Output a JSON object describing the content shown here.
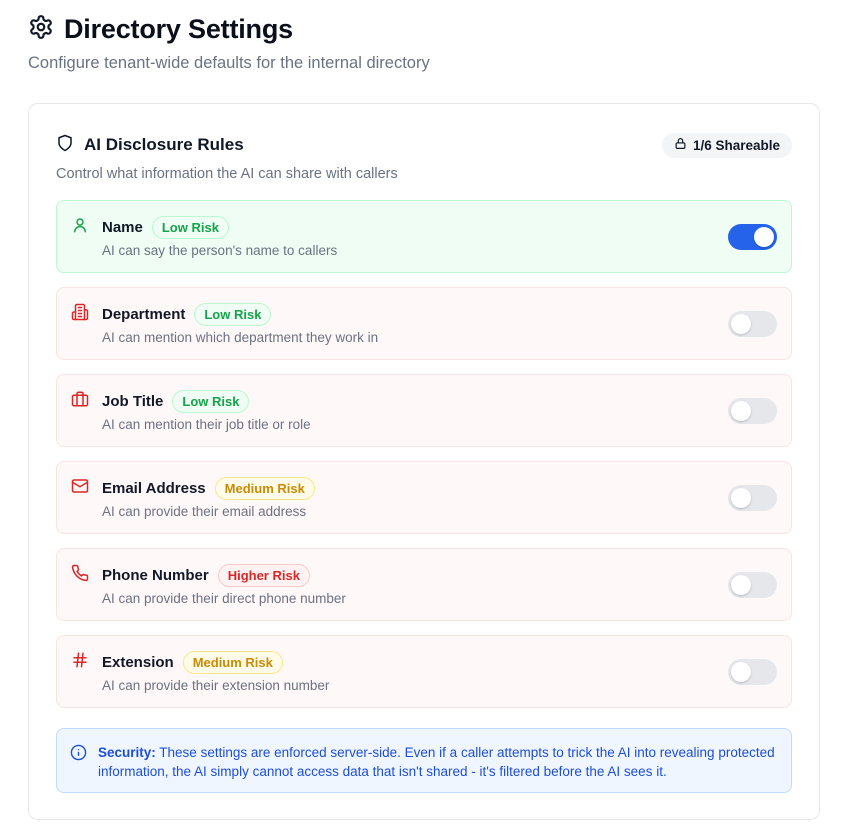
{
  "header": {
    "title": "Directory Settings",
    "subtitle": "Configure tenant-wide defaults for the internal directory",
    "icon": "gear-icon"
  },
  "card": {
    "title": "AI Disclosure Rules",
    "icon": "shield-icon",
    "shareable_badge": "1/6 Shareable",
    "description": "Control what information the AI can share with callers"
  },
  "rules": [
    {
      "icon": "user-icon",
      "name": "Name",
      "risk": "Low Risk",
      "risk_level": "low",
      "description": "AI can say the person's name to callers",
      "enabled": true
    },
    {
      "icon": "building-icon",
      "name": "Department",
      "risk": "Low Risk",
      "risk_level": "low",
      "description": "AI can mention which department they work in",
      "enabled": false
    },
    {
      "icon": "briefcase-icon",
      "name": "Job Title",
      "risk": "Low Risk",
      "risk_level": "low",
      "description": "AI can mention their job title or role",
      "enabled": false
    },
    {
      "icon": "mail-icon",
      "name": "Email Address",
      "risk": "Medium Risk",
      "risk_level": "medium",
      "description": "AI can provide their email address",
      "enabled": false
    },
    {
      "icon": "phone-icon",
      "name": "Phone Number",
      "risk": "Higher Risk",
      "risk_level": "high",
      "description": "AI can provide their direct phone number",
      "enabled": false
    },
    {
      "icon": "hash-icon",
      "name": "Extension",
      "risk": "Medium Risk",
      "risk_level": "medium",
      "description": "AI can provide their extension number",
      "enabled": false
    }
  ],
  "notice": {
    "label": "Security:",
    "text": "These settings are enforced server-side. Even if a caller attempts to trick the AI into revealing protected information, the AI simply cannot access data that isn't shared - it's filtered before the AI sees it."
  },
  "colors": {
    "accent": "#2563eb",
    "enabled_row_bg": "#f0fdf4",
    "disabled_row_bg": "#fff8f8",
    "low_risk": "#16a34a",
    "medium_risk": "#ca8a04",
    "higher_risk": "#dc2626"
  }
}
